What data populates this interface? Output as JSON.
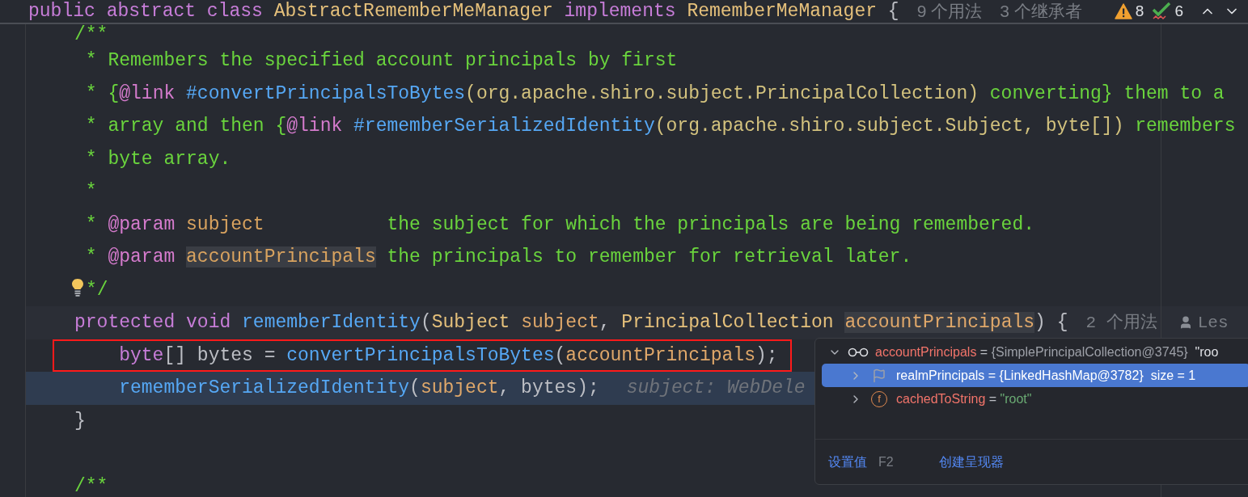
{
  "header": {
    "tokens": [
      {
        "text": "public ",
        "kind": "keyword"
      },
      {
        "text": "abstract ",
        "kind": "keyword"
      },
      {
        "text": "class ",
        "kind": "keyword"
      },
      {
        "text": "AbstractRememberMeManager ",
        "kind": "type"
      },
      {
        "text": "implements ",
        "kind": "keyword"
      },
      {
        "text": "RememberMeManager",
        "kind": "type"
      },
      {
        "text": " {",
        "kind": "plain"
      }
    ],
    "inlays": [
      {
        "text": "9 个用法"
      },
      {
        "text": "3 个继承者"
      }
    ],
    "indicators": [
      {
        "kind": "warning",
        "count": "8"
      },
      {
        "kind": "check",
        "count": "6"
      }
    ]
  },
  "lines": [
    {
      "kind": "code",
      "tokens": [
        {
          "text": "/**",
          "kind": "comment"
        }
      ]
    },
    {
      "kind": "code",
      "tokens": [
        {
          "text": " * Remembers the specified account principals by first",
          "kind": "comment"
        }
      ]
    },
    {
      "kind": "code",
      "tokens": [
        {
          "text": " * {",
          "kind": "comment"
        },
        {
          "text": "@link",
          "kind": "tag"
        },
        {
          "text": " #convertPrincipalsToBytes",
          "kind": "docref"
        },
        {
          "text": "(org.apache.shiro.subject.PrincipalCollection)",
          "kind": "docpath"
        },
        {
          "text": " converting} them to a",
          "kind": "comment"
        }
      ]
    },
    {
      "kind": "code",
      "tokens": [
        {
          "text": " * array and then {",
          "kind": "comment"
        },
        {
          "text": "@link",
          "kind": "tag"
        },
        {
          "text": " #rememberSerializedIdentity",
          "kind": "docref"
        },
        {
          "text": "(org.apache.shiro.subject.Subject, byte[])",
          "kind": "docpath"
        },
        {
          "text": " remembers",
          "kind": "comment"
        }
      ]
    },
    {
      "kind": "code",
      "tokens": [
        {
          "text": " * byte array.",
          "kind": "comment"
        }
      ]
    },
    {
      "kind": "code",
      "tokens": [
        {
          "text": " *",
          "kind": "comment"
        }
      ]
    },
    {
      "kind": "code",
      "tokens": [
        {
          "text": " * ",
          "kind": "comment"
        },
        {
          "text": "@param",
          "kind": "tag"
        },
        {
          "text": " subject",
          "kind": "docparam"
        },
        {
          "text": "           the subject for which the principals are being remembered.",
          "kind": "comment"
        }
      ]
    },
    {
      "kind": "code",
      "tokens": [
        {
          "text": " * ",
          "kind": "comment"
        },
        {
          "text": "@param ",
          "kind": "tag"
        },
        {
          "text": "accountPrincipals",
          "kind": "docparam",
          "marked": true
        },
        {
          "text": " the principals to remember for retrieval later.",
          "kind": "comment"
        }
      ]
    },
    {
      "kind": "code",
      "bulb": true,
      "tokens": [
        {
          "text": "*/",
          "kind": "comment"
        }
      ]
    },
    {
      "kind": "code",
      "caret_line": true,
      "tokens": [
        {
          "text": "protected ",
          "kind": "keyword"
        },
        {
          "text": "void ",
          "kind": "keyword"
        },
        {
          "text": "rememberIdentity",
          "kind": "method"
        },
        {
          "text": "(",
          "kind": "plain"
        },
        {
          "text": "Subject ",
          "kind": "type"
        },
        {
          "text": "subject",
          "kind": "param"
        },
        {
          "text": ", ",
          "kind": "plain"
        },
        {
          "text": "PrincipalCollection ",
          "kind": "type"
        },
        {
          "text": "accountPrincipals",
          "kind": "param",
          "marked": true
        },
        {
          "text": ") {",
          "kind": "plain"
        }
      ],
      "inlays": [
        {
          "kind": "usages",
          "text": "2 个用法"
        },
        {
          "kind": "author",
          "text": "Les"
        }
      ]
    },
    {
      "kind": "code",
      "boxed": true,
      "tokens": [
        {
          "text": "    byte",
          "kind": "keyword"
        },
        {
          "text": "[] bytes = ",
          "kind": "plain"
        },
        {
          "text": "convertPrincipalsToBytes",
          "kind": "method"
        },
        {
          "text": "(",
          "kind": "plain"
        },
        {
          "text": "accountPrincipals",
          "kind": "param"
        },
        {
          "text": ");",
          "kind": "plain"
        }
      ]
    },
    {
      "kind": "code",
      "execution_point": true,
      "tokens": [
        {
          "text": "    rememberSerializedIdentity",
          "kind": "method"
        },
        {
          "text": "(",
          "kind": "plain"
        },
        {
          "text": "subject",
          "kind": "param"
        },
        {
          "text": ", bytes);",
          "kind": "plain"
        }
      ],
      "inlays": [
        {
          "kind": "hint",
          "text": "subject: WebDele"
        }
      ]
    },
    {
      "kind": "code",
      "tokens": [
        {
          "text": "}",
          "kind": "plain"
        }
      ]
    },
    {
      "kind": "blank"
    },
    {
      "kind": "code",
      "tokens": [
        {
          "text": "/**",
          "kind": "comment"
        }
      ]
    }
  ],
  "debugger_popup": {
    "tree": [
      {
        "kind": "watch",
        "name": "accountPrincipals",
        "op": "=",
        "value": "{SimplePrincipalCollection@3745}",
        "extra": "\"roo",
        "expanded": true,
        "selected": false,
        "children": [
          {
            "kind": "flag",
            "name": "realmPrincipals",
            "op": "=",
            "value": "{LinkedHashMap@3782}",
            "extra": "size = 1",
            "expanded": false,
            "selected": true
          },
          {
            "kind": "field",
            "badge": "f",
            "name": "cachedToString",
            "op": "=",
            "value": "\"root\"",
            "expanded": false,
            "selected": false
          }
        ]
      }
    ],
    "actions": [
      {
        "label": "设置值",
        "shortcut": "F2"
      },
      {
        "label": "创建呈现器"
      }
    ]
  }
}
